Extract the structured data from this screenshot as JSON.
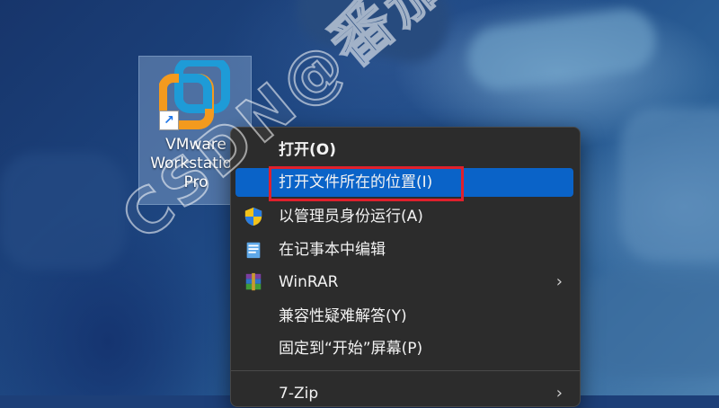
{
  "desktop": {
    "icon_label_line1": "VMware",
    "icon_label_line2": "Workstation",
    "icon_label_line3": "Pro",
    "icon_name": "vmware-workstation-icon"
  },
  "context_menu": {
    "items": [
      {
        "label": "打开(O)",
        "bold": true
      },
      {
        "label": "打开文件所在的位置(I)",
        "highlighted": true
      },
      {
        "label": "以管理员身份运行(A)",
        "icon": "uac-shield-icon"
      },
      {
        "label": "在记事本中编辑",
        "icon": "notepad-icon"
      },
      {
        "label": "WinRAR",
        "icon": "winrar-icon",
        "has_submenu": true
      },
      {
        "label": "兼容性疑难解答(Y)"
      },
      {
        "label": "固定到“开始”屏幕(P)"
      },
      {
        "label": "7-Zip",
        "has_submenu": true
      }
    ]
  },
  "watermark": "CSDN@番茄软件",
  "colors": {
    "menu_bg": "#2c2c2c",
    "hover_bg": "#0a63c8",
    "annotation_red": "#e0202c"
  }
}
